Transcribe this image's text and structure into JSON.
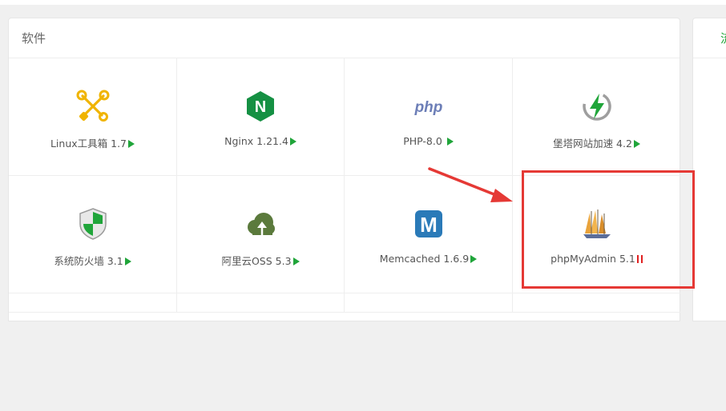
{
  "panel": {
    "title": "软件"
  },
  "side_panel": {
    "tab_label": "流"
  },
  "apps": [
    {
      "name": "Linux工具箱 1.7",
      "icon": "tools-icon",
      "status": "running"
    },
    {
      "name": "Nginx 1.21.4",
      "icon": "nginx-icon",
      "status": "running",
      "icon_letter": "N"
    },
    {
      "name": "PHP-8.0 ",
      "icon": "php-icon",
      "status": "running",
      "icon_text": "php"
    },
    {
      "name": "堡塔网站加速 4.2",
      "icon": "lightning-icon",
      "status": "running"
    },
    {
      "name": "系统防火墙 3.1",
      "icon": "shield-icon",
      "status": "running"
    },
    {
      "name": "阿里云OSS 5.3",
      "icon": "cloud-upload-icon",
      "status": "running"
    },
    {
      "name": "Memcached 1.6.9",
      "icon": "memcached-icon",
      "status": "running",
      "icon_letter": "M"
    },
    {
      "name": "phpMyAdmin 5.1",
      "icon": "sailboat-icon",
      "status": "stopped"
    }
  ],
  "colors": {
    "green": "#20a53a",
    "red": "#e02020",
    "highlight": "#e53935",
    "php": "#6c7eb7",
    "memcached": "#2a7ab8"
  }
}
